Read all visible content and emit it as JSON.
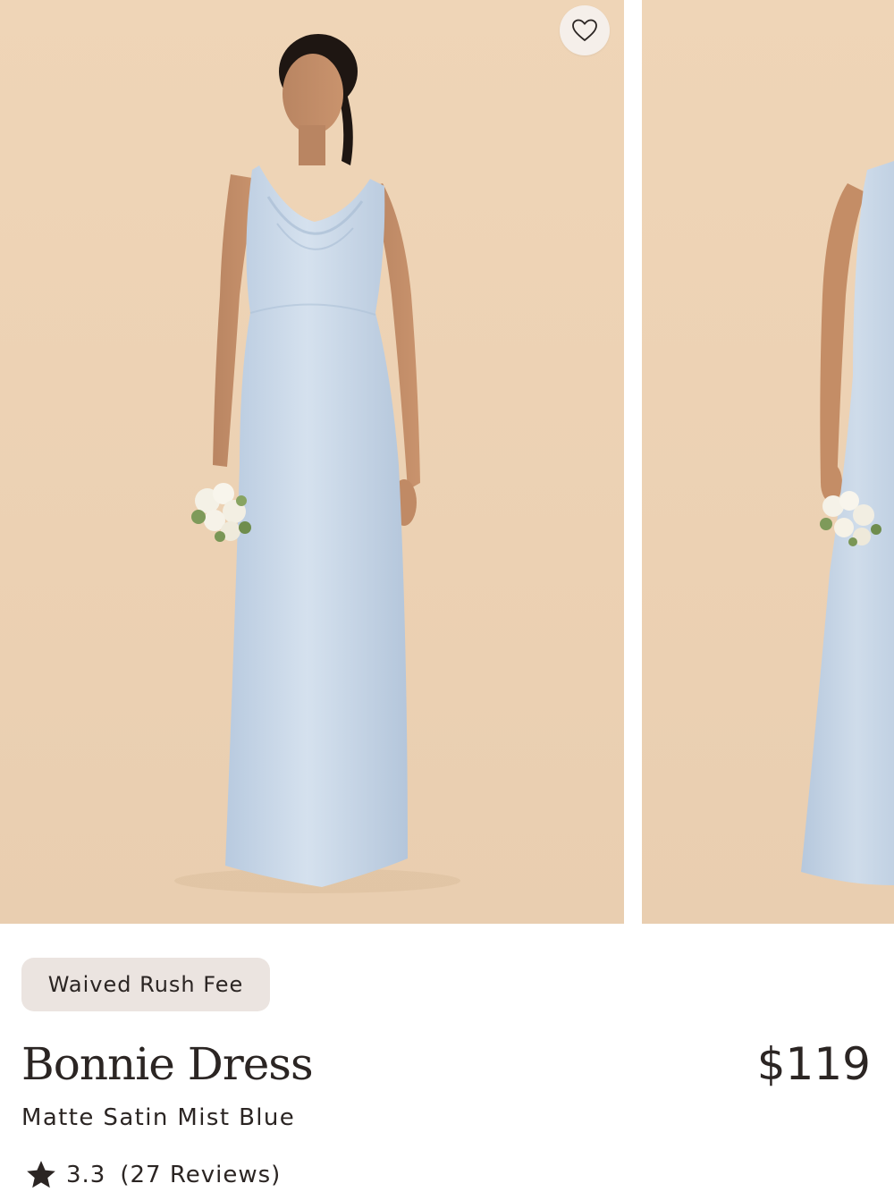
{
  "product": {
    "badge": "Waived Rush Fee",
    "name": "Bonnie Dress",
    "price": "$119",
    "variant": "Matte Satin Mist Blue",
    "rating": "3.3",
    "reviews_label": "(27 Reviews)",
    "images": [
      {
        "alt": "Model wearing dress, front view"
      },
      {
        "alt": "Model wearing dress, side view"
      }
    ]
  },
  "colors": {
    "background_photo": "#ecd1b3",
    "dress": "#c6d6e7",
    "badge_bg": "#ebe4e0",
    "text": "#2b2523"
  },
  "icons": {
    "wishlist": "heart-outline-icon",
    "rating": "star-icon"
  }
}
